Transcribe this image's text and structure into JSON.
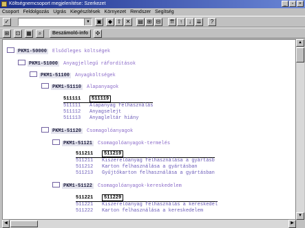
{
  "window": {
    "title": "Költségnemcsoport megjelenítése: Szerkezet"
  },
  "menu": [
    "Csoport",
    "Feldolgozás",
    "Ugrás",
    "Kiegészítések",
    "Környezet",
    "Rendszer",
    "Segítség"
  ],
  "toolbar2": {
    "report_button": "Beszámoló-info"
  },
  "tree": {
    "root": {
      "code": "PKM1-50000",
      "name": "Elsődleges költségek"
    },
    "n1": {
      "code": "PKM1-51000",
      "name": "Anyagjellegű ráfordítások"
    },
    "n2": {
      "code": "PKM1-51100",
      "name": "Anyagköltségek"
    },
    "n3": {
      "code": "PKM1-51110",
      "name": "Alapanyagok"
    },
    "n3_list": {
      "from": "511111",
      "to": "511119",
      "items": [
        {
          "code": "511111",
          "name": "Alapanyag felhasználás"
        },
        {
          "code": "511112",
          "name": "Anyagselejt"
        },
        {
          "code": "511113",
          "name": "Anyagleltár hiány"
        }
      ]
    },
    "n4": {
      "code": "PKM1-51120",
      "name": "Csomagolóanyagok"
    },
    "n5": {
      "code": "PKM1-51121",
      "name": "Csomagolóanyagok-termelés"
    },
    "n5_list": {
      "from": "511211",
      "to": "511219",
      "items": [
        {
          "code": "511211",
          "name": "Kiszerelőanyag  felhasználása a gyártásb"
        },
        {
          "code": "511212",
          "name": "Karton felhasználása a gyártásban"
        },
        {
          "code": "511213",
          "name": "Gyűjtőkarton felhasználása a gyártásban"
        }
      ]
    },
    "n6": {
      "code": "PKM1-51122",
      "name": "Csomagolóanyagok-kereskedelem"
    },
    "n6_list": {
      "from": "511221",
      "to": "511229",
      "items": [
        {
          "code": "511221",
          "name": "Kiszerelőanyag felhasználás a kereskedel"
        },
        {
          "code": "511222",
          "name": "Karton felhasználása a kereskedelem"
        }
      ]
    }
  }
}
